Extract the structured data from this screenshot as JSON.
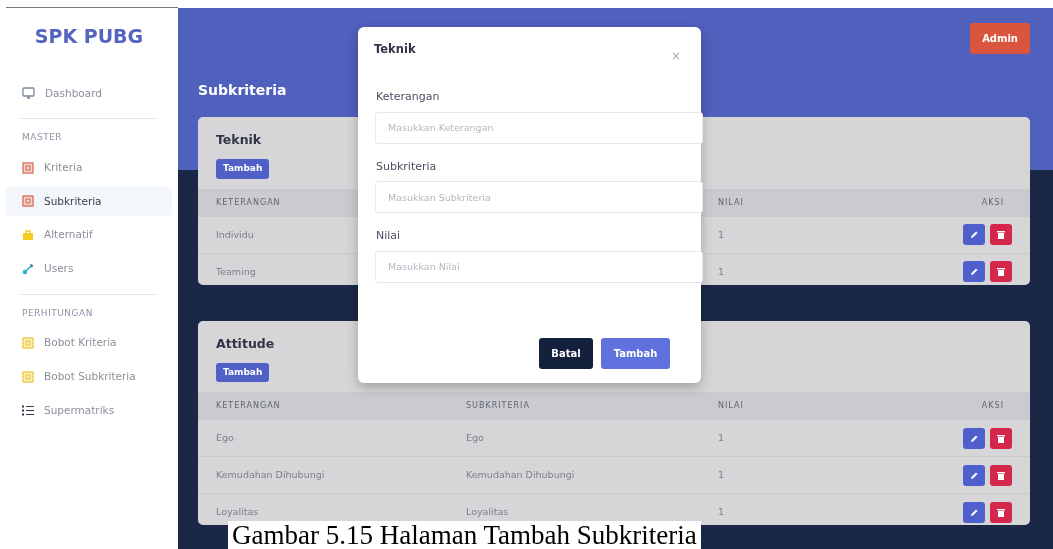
{
  "sidebar": {
    "brand": "SPK PUBG",
    "sections": [
      {
        "items": [
          {
            "label": "Dashboard",
            "selected": false
          }
        ]
      },
      {
        "heading": "MASTER",
        "items": [
          {
            "label": "Kriteria",
            "selected": false
          },
          {
            "label": "Subkriteria",
            "selected": true
          },
          {
            "label": "Alternatif",
            "selected": false
          },
          {
            "label": "Users",
            "selected": false
          }
        ]
      },
      {
        "heading": "PERHITUNGAN",
        "items": [
          {
            "label": "Bobot Kriteria",
            "selected": false
          },
          {
            "label": "Bobot Subkriteria",
            "selected": false
          },
          {
            "label": "Supermatriks",
            "selected": false
          }
        ]
      }
    ]
  },
  "topbar": {
    "user_button": "Admin"
  },
  "page_title": "Subkriteria",
  "cards": [
    {
      "title": "Teknik",
      "add_button": "Tambah",
      "columns": {
        "keterangan": "KETERANGAN",
        "nilai": "NILAI",
        "aksi": "AKSI"
      },
      "rows": [
        {
          "keterangan": "Individu",
          "nilai": "1"
        },
        {
          "keterangan": "Teaming",
          "nilai": "1"
        }
      ]
    },
    {
      "title": "Attitude",
      "add_button": "Tambah",
      "columns": {
        "keterangan": "KETERANGAN",
        "subkriteria": "SUBKRITERIA",
        "nilai": "NILAI",
        "aksi": "AKSI"
      },
      "rows": [
        {
          "keterangan": "Ego",
          "subkriteria": "Ego",
          "nilai": "1"
        },
        {
          "keterangan": "Kemudahan Dihubungi",
          "subkriteria": "Kemudahan Dihubungi",
          "nilai": "1"
        },
        {
          "keterangan": "Loyalitas",
          "subkriteria": "Loyalitas",
          "nilai": "1"
        }
      ]
    }
  ],
  "modal": {
    "title": "Teknik",
    "close": "×",
    "fields": [
      {
        "label": "Keterangan",
        "placeholder": "Masukkan Keterangan"
      },
      {
        "label": "Subkriteria",
        "placeholder": "Masukkan Subkriteria"
      },
      {
        "label": "Nilai",
        "placeholder": "Masukkan Nilai"
      }
    ],
    "cancel_button": "Batal",
    "submit_button": "Tambah"
  },
  "caption": "Gambar 5.15 Halaman Tambah Subkriteria"
}
